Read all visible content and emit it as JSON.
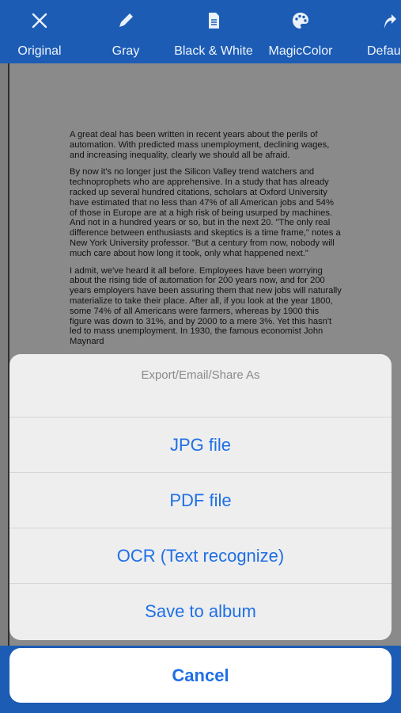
{
  "colors": {
    "toolbar": "#1c5cb5",
    "action_text": "#1f6fe5",
    "title_text": "#8a8a8a"
  },
  "toolbar": {
    "items": [
      {
        "label": "Original",
        "icon": "wand-off-icon"
      },
      {
        "label": "Gray",
        "icon": "pencil-icon"
      },
      {
        "label": "Black & White",
        "icon": "document-icon"
      },
      {
        "label": "MagicColor",
        "icon": "palette-icon"
      },
      {
        "label": "Defau",
        "icon": "share-arrow-icon"
      }
    ]
  },
  "document": {
    "paragraphs": [
      "A great deal has been written in recent years about the perils of automation. With predicted mass unemployment, declining wages, and increasing inequality, clearly we should all be afraid.",
      "By now it's no longer just the Silicon Valley trend watchers and technoprophets who are apprehensive. In a study that has already racked up several hundred citations, scholars at Oxford University have estimated that no less than 47% of all American jobs and 54% of those in Europe are at a high risk of being usurped by machines. And not in a hundred years or so, but in the next 20. \"The only real difference between enthusiasts and skeptics is a time frame,\" notes a New York University professor. \"But a century from now, nobody will much care about how long it took, only what happened next.\"",
      "I admit, we've heard it all before. Employees have been worrying about the rising tide of automation for 200 years now, and for 200 years employers have been assuring them that new jobs will naturally materialize to take their place. After all, if you look at the year 1800, some 74% of all Americans were farmers, whereas by 1900 this figure was down to 31%, and by 2000 to a mere 3%. Yet this hasn't led to mass unemployment. In 1930, the famous economist John Maynard"
    ]
  },
  "action_sheet": {
    "title": "Export/Email/Share As",
    "options": [
      {
        "label": "JPG file"
      },
      {
        "label": "PDF file"
      },
      {
        "label": "OCR (Text recognize)"
      },
      {
        "label": "Save to album"
      }
    ],
    "cancel_label": "Cancel"
  }
}
